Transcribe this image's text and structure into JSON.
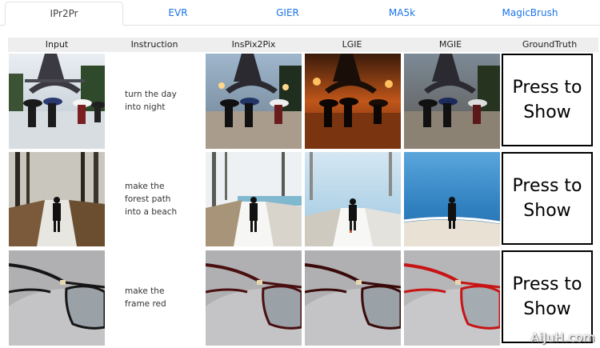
{
  "tabs": [
    {
      "label": "IPr2Pr",
      "active": true
    },
    {
      "label": "EVR",
      "active": false
    },
    {
      "label": "GIER",
      "active": false
    },
    {
      "label": "MA5k",
      "active": false
    },
    {
      "label": "MagicBrush",
      "active": false
    }
  ],
  "table": {
    "headers": [
      "Input",
      "Instruction",
      "InsPix2Pix",
      "LGIE",
      "MGIE",
      "GroundTruth"
    ],
    "rows": [
      {
        "instruction_lines": [
          "turn the day",
          "into night"
        ],
        "ground_truth_lines": [
          "Press to",
          "Show"
        ]
      },
      {
        "instruction_lines": [
          "make the",
          "forest path",
          "into a beach"
        ],
        "ground_truth_lines": [
          "Press to",
          "Show"
        ]
      },
      {
        "instruction_lines": [
          "make the",
          "frame red"
        ],
        "ground_truth_lines": [
          "Press to",
          "Show"
        ]
      }
    ]
  },
  "images": {
    "row1": [
      "paris-rain-umbrellas",
      "paris-rain-night",
      "paris-orange-night",
      "paris-night-muted"
    ],
    "row2": [
      "forest-path-walker",
      "snowy-forest-lake",
      "snowy-shore-walker",
      "beach-walker"
    ],
    "row3": [
      "black-glasses",
      "dark-red-glasses",
      "dark-red-glasses",
      "bright-red-glasses"
    ]
  },
  "watermark": "AiJuH.com",
  "colors": {
    "tab_link": "#1a73e8",
    "header_bg": "#eeeeee",
    "border": "#dee2e6"
  }
}
